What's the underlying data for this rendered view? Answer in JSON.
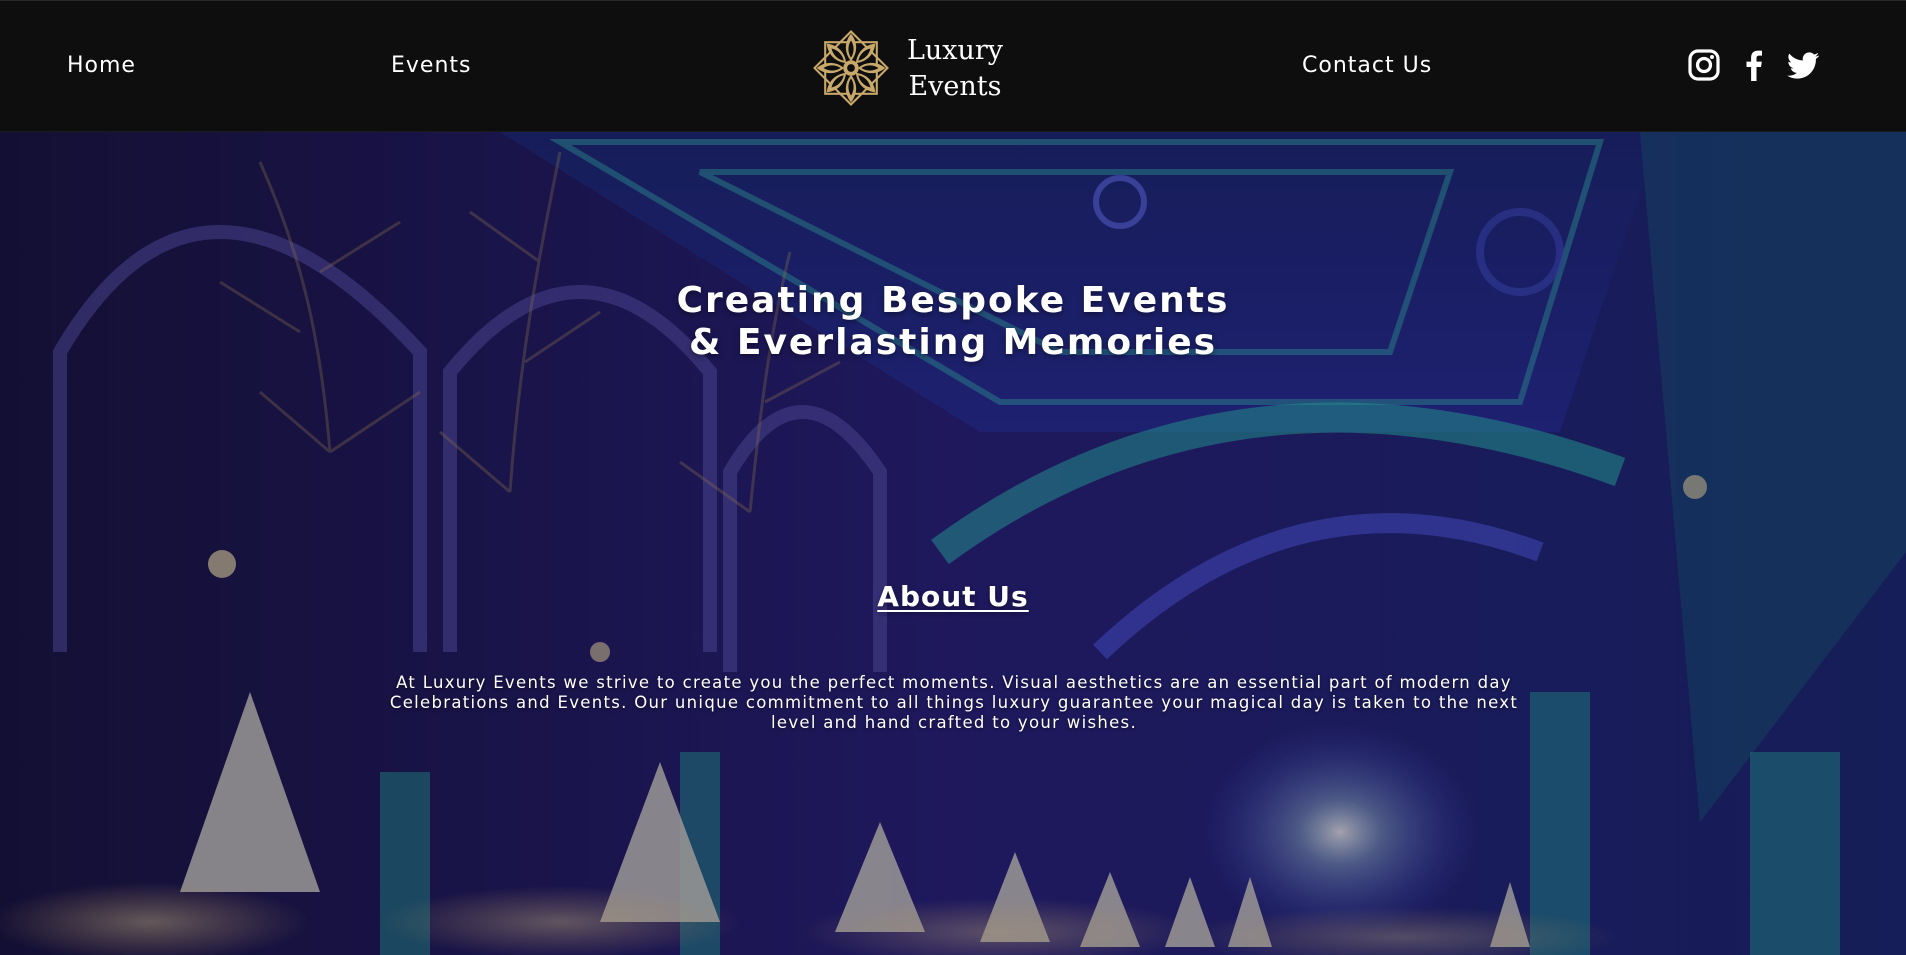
{
  "nav": {
    "home_label": "Home",
    "events_label": "Events",
    "contact_label": "Contact Us"
  },
  "logo": {
    "line1": "Luxury",
    "line2": "Events",
    "icon": "mandala-flower-icon"
  },
  "social": {
    "instagram_icon": "instagram-icon",
    "facebook_icon": "facebook-icon",
    "twitter_icon": "twitter-icon"
  },
  "hero": {
    "title_line1": "Creating Bespoke Events",
    "title_line2": "& Everlasting Memories"
  },
  "about": {
    "heading": "About Us",
    "body": "At Luxury Events we strive to create you the perfect moments. Visual aesthetics are an essential part of modern day Celebrations and Events. Our unique commitment to all things luxury guarantee your magical day is taken to the next level and hand crafted to your wishes."
  },
  "colors": {
    "header_bg": "#0e0e0e",
    "logo_gold": "#c8a96a",
    "hero_blue": "#2d2a9a",
    "hero_teal": "#2fd6c4",
    "text": "#ffffff"
  }
}
